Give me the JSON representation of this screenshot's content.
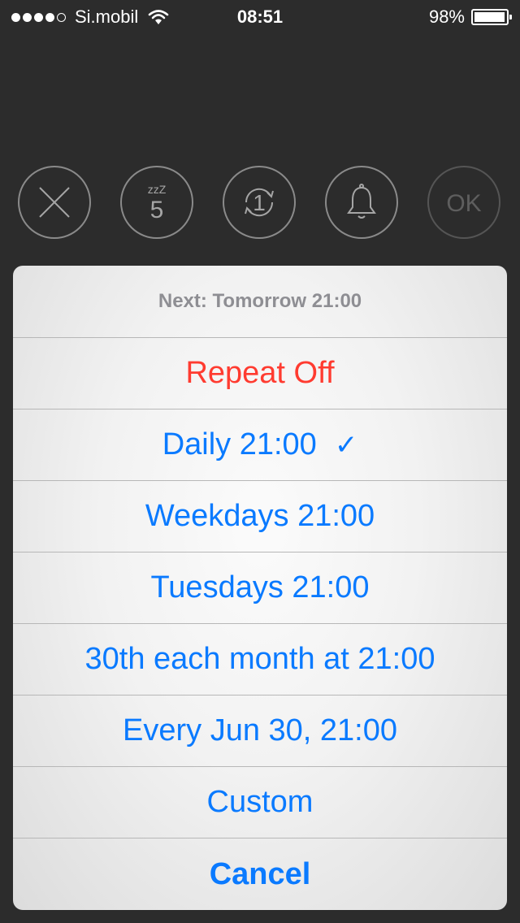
{
  "status_bar": {
    "carrier": "Si.mobil",
    "time": "08:51",
    "battery": "98%",
    "battery_level": 0.98,
    "signal_bars_filled": 4,
    "signal_bars_total": 5
  },
  "toolbar": {
    "buttons": [
      {
        "icon": "close-icon"
      },
      {
        "icon": "snooze-icon",
        "text": "5",
        "sub": "zzZ"
      },
      {
        "icon": "repeat-icon",
        "text": "1"
      },
      {
        "icon": "bell-icon"
      },
      {
        "icon": "ok-icon",
        "text": "OK"
      }
    ]
  },
  "sheet": {
    "header": "Next: Tomorrow 21:00",
    "options": [
      {
        "label": "Repeat Off"
      },
      {
        "label": "Daily 21:00",
        "check": "✓"
      },
      {
        "label": "Weekdays 21:00"
      },
      {
        "label": "Tuesdays 21:00"
      },
      {
        "label": "30th each month at 21:00"
      },
      {
        "label": "Every Jun 30, 21:00"
      },
      {
        "label": "Custom"
      }
    ],
    "cancel": "Cancel"
  },
  "colors": {
    "accent": "#0a7aff",
    "destructive": "#ff3b30",
    "background": "#2c2c2c"
  }
}
